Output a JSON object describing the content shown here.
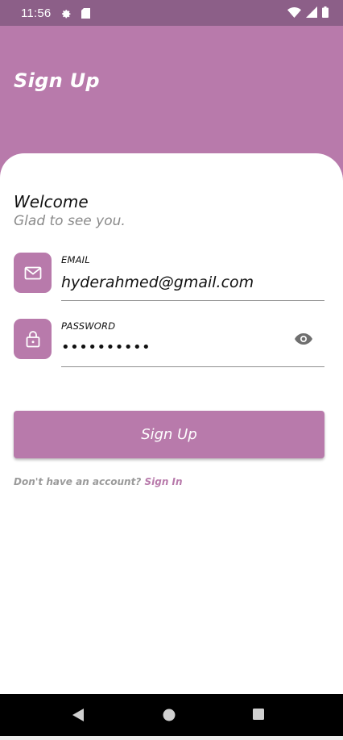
{
  "status_bar": {
    "time": "11:56",
    "icons": [
      "gear-icon",
      "sd-card-icon",
      "wifi-icon",
      "signal-icon",
      "battery-icon"
    ]
  },
  "header": {
    "title": "Sign Up"
  },
  "welcome": {
    "title": "Welcome",
    "subtitle": "Glad to see you."
  },
  "form": {
    "email": {
      "label": "EMAIL",
      "value": "hyderahmed@gmail.com",
      "icon": "mail-icon"
    },
    "password": {
      "label": "PASSWORD",
      "masked_value": "••••••••••",
      "icon": "lock-icon",
      "toggle_icon": "eye-icon"
    }
  },
  "actions": {
    "signup_label": "Sign Up",
    "signin_prompt": "Don't have an account?",
    "signin_link": "Sign In"
  },
  "colors": {
    "accent": "#b87aab",
    "status_bar": "#8c5f88",
    "text_dark": "#111111",
    "text_muted": "#8a8a8a"
  }
}
